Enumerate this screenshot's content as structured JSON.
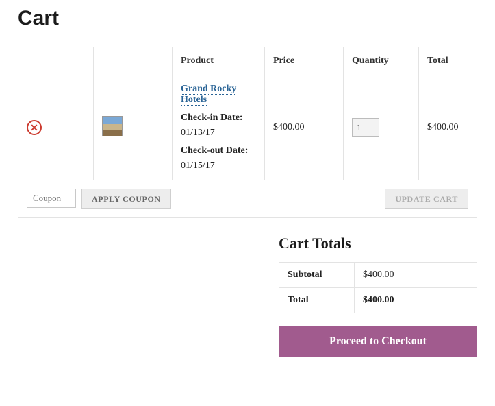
{
  "page": {
    "title": "Cart"
  },
  "columns": {
    "product": "Product",
    "price": "Price",
    "quantity": "Quantity",
    "total": "Total"
  },
  "item": {
    "name": "Grand Rocky Hotels",
    "checkin_label": "Check-in Date:",
    "checkin_value": "01/13/17",
    "checkout_label": "Check-out Date:",
    "checkout_value": "01/15/17",
    "price": "$400.00",
    "quantity": "1",
    "total": "$400.00"
  },
  "actions": {
    "coupon_placeholder": "Coupon",
    "apply_coupon": "APPLY COUPON",
    "update_cart": "UPDATE CART"
  },
  "totals": {
    "heading": "Cart Totals",
    "subtotal_label": "Subtotal",
    "subtotal_value": "$400.00",
    "total_label": "Total",
    "total_value": "$400.00"
  },
  "checkout": {
    "label": "Proceed to Checkout"
  }
}
